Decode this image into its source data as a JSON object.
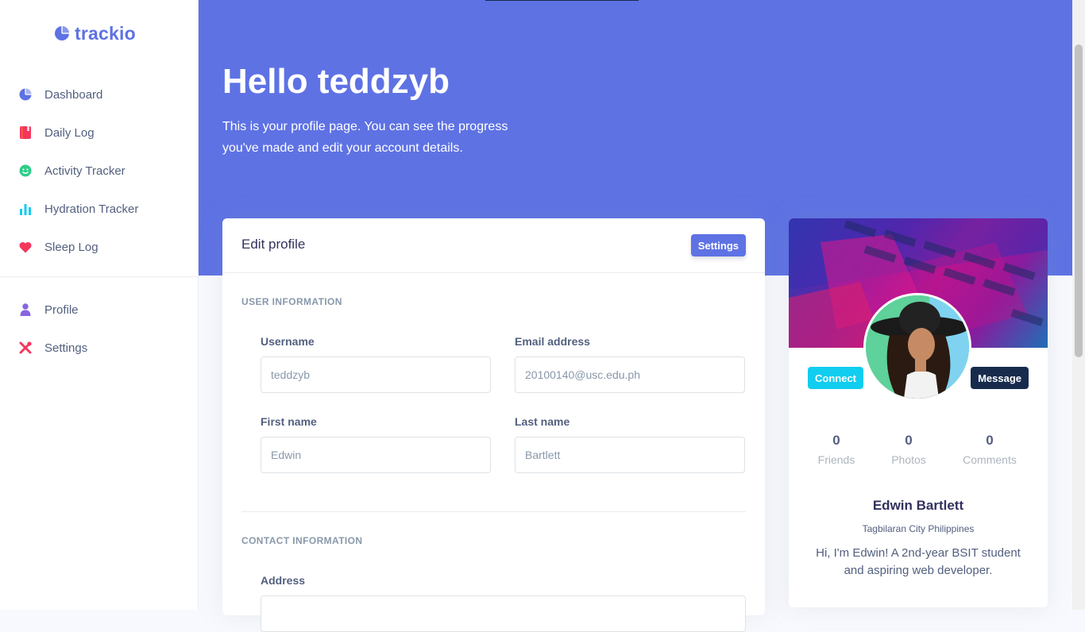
{
  "brand": {
    "name": "trackio"
  },
  "sidebar": {
    "items": [
      {
        "label": "Dashboard",
        "icon": "pie-chart-icon",
        "color": "#5e72e4"
      },
      {
        "label": "Daily Log",
        "icon": "book-icon",
        "color": "#f5365c"
      },
      {
        "label": "Activity Tracker",
        "icon": "smile-icon",
        "color": "#2dce89"
      },
      {
        "label": "Hydration Tracker",
        "icon": "bar-chart-icon",
        "color": "#11cdef"
      },
      {
        "label": "Sleep Log",
        "icon": "heart-icon",
        "color": "#f5365c"
      }
    ],
    "account_items": [
      {
        "label": "Profile",
        "icon": "user-icon",
        "color": "#8965e0"
      },
      {
        "label": "Settings",
        "icon": "tools-icon",
        "color": "#f5365c"
      }
    ]
  },
  "hero": {
    "title": "Hello teddzyb",
    "description": "This is your profile page. You can see the progress you've made and edit your account details."
  },
  "edit_profile": {
    "title": "Edit profile",
    "settings_label": "Settings",
    "user_section": "USER INFORMATION",
    "contact_section": "CONTACT INFORMATION",
    "fields": {
      "username": {
        "label": "Username",
        "value": "teddzyb"
      },
      "email": {
        "label": "Email address",
        "value": "20100140@usc.edu.ph"
      },
      "first_name": {
        "label": "First name",
        "value": "Edwin"
      },
      "last_name": {
        "label": "Last name",
        "value": "Bartlett"
      },
      "address": {
        "label": "Address",
        "value": ""
      }
    }
  },
  "profile_card": {
    "connect_label": "Connect",
    "message_label": "Message",
    "stats": [
      {
        "value": "0",
        "label": "Friends"
      },
      {
        "value": "0",
        "label": "Photos"
      },
      {
        "value": "0",
        "label": "Comments"
      }
    ],
    "name": "Edwin Bartlett",
    "location": "Tagbilaran City Philippines",
    "bio": "Hi, I'm Edwin! A 2nd-year BSIT student and aspiring web developer."
  },
  "colors": {
    "primary": "#5e72e4",
    "info": "#11cdef",
    "dark": "#172b4d"
  }
}
